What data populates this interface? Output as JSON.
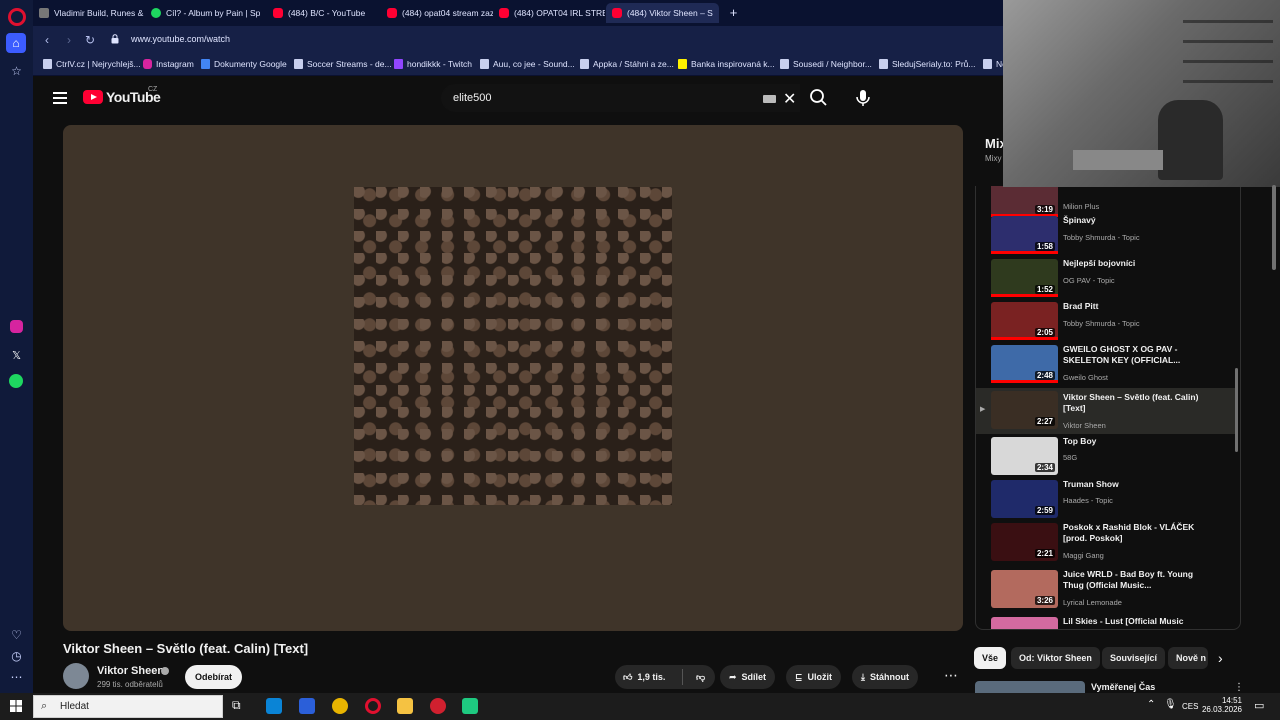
{
  "browser": {
    "tabs": [
      {
        "label": "Vladimir Build, Runes & C",
        "icon": "league-icon"
      },
      {
        "label": "Cíl? - Album by Pain | Spo",
        "icon": "spotify-icon"
      },
      {
        "label": "(484) B/C - YouTube",
        "icon": "youtube-icon"
      },
      {
        "label": "(484) opat04 stream zazn",
        "icon": "youtube-icon"
      },
      {
        "label": "(484) OPAT04 IRL STREAM",
        "icon": "youtube-icon"
      },
      {
        "label": "(484) Viktor Sheen – S",
        "icon": "youtube-icon"
      }
    ],
    "url": "www.youtube.com/watch",
    "bookmarks": [
      "CtrlV.cz | Nejrychlejš...",
      "Instagram",
      "Dokumenty Google",
      "Soccer Streams - de...",
      "hondikkk - Twitch",
      "Auu, co jee - Sound...",
      "Appka / Stáhni a ze...",
      "Banka inspirovaná k...",
      "Sousedi / Neighbor...",
      "SledujSerialy.to: Prů...",
      "Ne"
    ]
  },
  "youtube": {
    "logo_text": "YouTube",
    "region": "CZ",
    "search_value": "elite500"
  },
  "video": {
    "title": "Viktor Sheen – Světlo (feat. Calin) [Text]",
    "channel": "Viktor Sheen",
    "subscribers": "299 tis. odběratelů",
    "subscribe_label": "Odebírat",
    "likes": "1,9 tis.",
    "share_label": "Sdílet",
    "save_label": "Uložit",
    "download_label": "Stáhnout"
  },
  "mix": {
    "title": "Mix",
    "subtitle": "Mixy"
  },
  "playlist": [
    {
      "title": "",
      "channel": "Milion Plus",
      "duration": "3:19",
      "thumb_color": "#5b2c34"
    },
    {
      "title": "Špinavý",
      "channel": "Tobby Shmurda - Topic",
      "duration": "1:58",
      "thumb_color": "#2d2e6e"
    },
    {
      "title": "Nejlepší bojovníci",
      "channel": "OG PAV - Topic",
      "duration": "1:52",
      "thumb_color": "#2f3a1e"
    },
    {
      "title": "Brad Pitt",
      "channel": "Tobby Shmurda - Topic",
      "duration": "2:05",
      "thumb_color": "#7a2222"
    },
    {
      "title": "GWEILO GHOST X OG PAV - SKELETON KEY (OFFICIAL...",
      "channel": "Gweilo Ghost",
      "duration": "2:48",
      "thumb_color": "#3e6aa8"
    },
    {
      "title": "Viktor Sheen – Světlo (feat. Calin) [Text]",
      "channel": "Viktor Sheen",
      "duration": "2:27",
      "thumb_color": "#3a2e24"
    },
    {
      "title": "Top Boy",
      "channel": "58G",
      "duration": "2:34",
      "thumb_color": "#d8d8d8"
    },
    {
      "title": "Truman Show",
      "channel": "Haades - Topic",
      "duration": "2:59",
      "thumb_color": "#1f2a6a"
    },
    {
      "title": "Poskok x Rashid Blok - VLÁČEK [prod. Poskok]",
      "channel": "Maggi Gang",
      "duration": "2:21",
      "thumb_color": "#3a0f12"
    },
    {
      "title": "Juice WRLD - Bad Boy ft. Young Thug (Official Music...",
      "channel": "Lyrical Lemonade",
      "duration": "3:26",
      "thumb_color": "#b36a5e"
    },
    {
      "title": "Lil Skies - Lust [Official Music",
      "channel": "",
      "duration": "",
      "thumb_color": "#d36aa0"
    }
  ],
  "chips": [
    "Vše",
    "Od: Viktor Sheen",
    "Související",
    "Nově n"
  ],
  "next_video": {
    "title": "Vyměřenej Čas"
  },
  "taskbar": {
    "search_placeholder": "Hledat",
    "language": "CES",
    "time": "14:51",
    "date": "26.03.2026"
  }
}
